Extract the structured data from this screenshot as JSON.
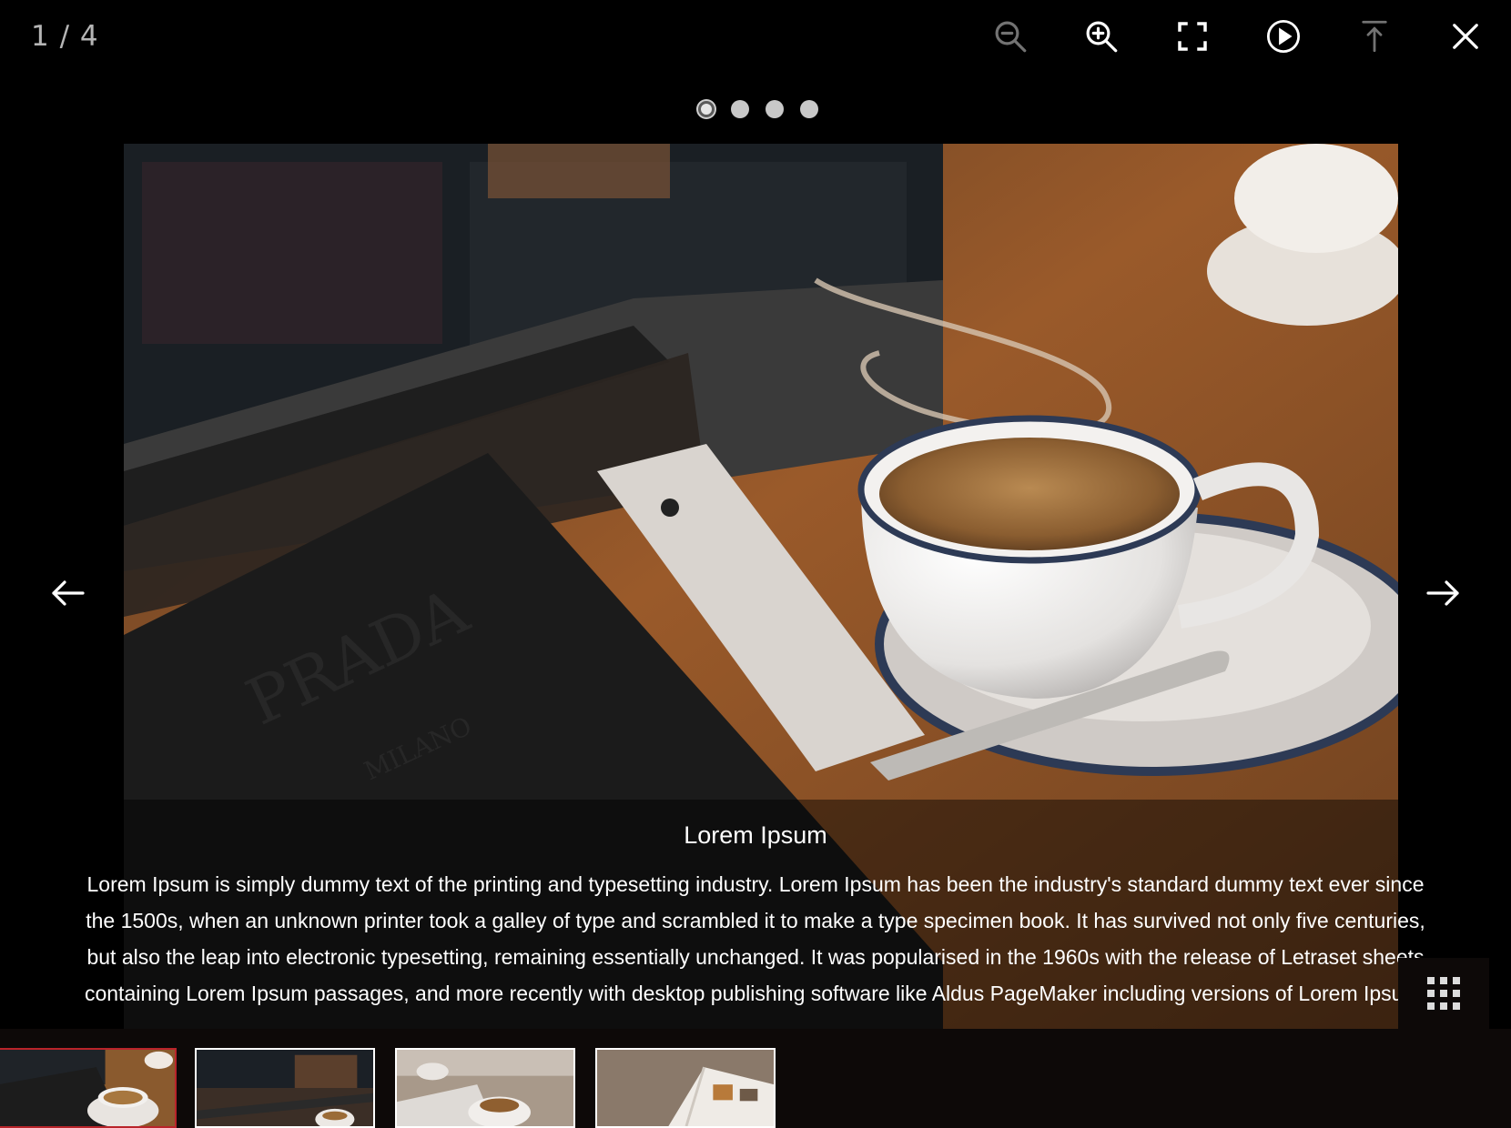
{
  "counter": {
    "current": "1",
    "separator": "/",
    "total": "4"
  },
  "toolbar": {
    "icons": [
      "zoom-out-icon",
      "zoom-in-icon",
      "fullscreen-icon",
      "play-icon",
      "download-icon",
      "close-icon"
    ]
  },
  "pager": {
    "count": 4,
    "active_index": 0
  },
  "caption": {
    "title": "Lorem Ipsum",
    "text": "Lorem Ipsum is simply dummy text of the printing and typesetting industry. Lorem Ipsum has been the industry's standard dummy text ever since the 1500s, when an unknown printer took a galley of type and scrambled it to make a type specimen book. It has survived not only five centuries, but also the leap into electronic typesetting, remaining essentially unchanged. It was popularised in the 1960s with the release of Letraset sheets containing Lorem Ipsum passages, and more recently with desktop publishing software like Aldus PageMaker including versions of Lorem Ipsum."
  },
  "image": {
    "logo_text": "PRADA",
    "logo_subtext": "MILANO"
  },
  "thumbnails": {
    "count": 4,
    "active_index": 0
  },
  "colors": {
    "active_thumb_border": "#b9242a",
    "background": "#000000",
    "thumb_bar": "#0d0908"
  }
}
